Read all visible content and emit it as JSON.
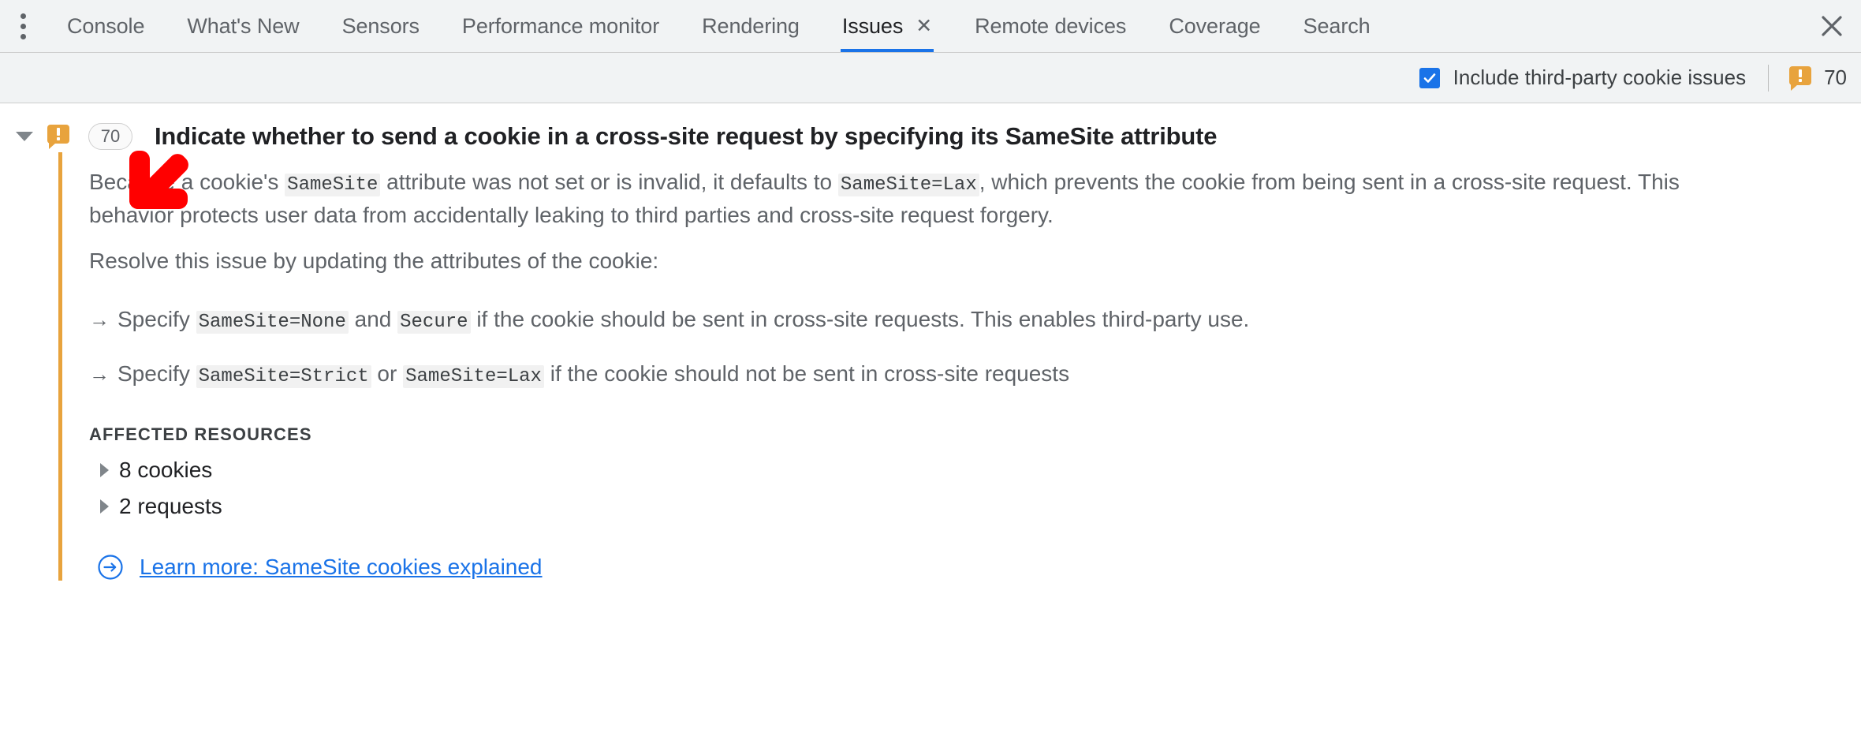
{
  "tabbar": {
    "menu_icon": "three-dot-vertical-menu-icon",
    "tabs": [
      {
        "label": "Console",
        "active": false
      },
      {
        "label": "What's New",
        "active": false
      },
      {
        "label": "Sensors",
        "active": false
      },
      {
        "label": "Performance monitor",
        "active": false
      },
      {
        "label": "Rendering",
        "active": false
      },
      {
        "label": "Issues",
        "active": true,
        "close_label": "✕"
      },
      {
        "label": "Remote devices",
        "active": false
      },
      {
        "label": "Coverage",
        "active": false
      },
      {
        "label": "Search",
        "active": false
      }
    ],
    "close_icon": "close-icon",
    "accent_color": "#1a73e8"
  },
  "toolbar": {
    "third_party_checkbox": {
      "label": "Include third-party cookie issues",
      "checked": true
    },
    "issue_count_icon": "warning-issue-icon",
    "issue_count": "70",
    "warning_color": "#e8a33d"
  },
  "issue": {
    "expanded": true,
    "expand_icon": "chevron-down-icon",
    "severity_icon": "warning-issue-icon",
    "count_badge": "70",
    "title": "Indicate whether to send a cookie in a cross-site request by specifying its SameSite attribute",
    "description": {
      "p1_a": "Because a cookie's ",
      "p1_code1": "SameSite",
      "p1_b": " attribute was not set or is invalid, it defaults to ",
      "p1_code2": "SameSite=Lax",
      "p1_c": ", which prevents the cookie from being sent in a cross-site request. This behavior protects user data from accidentally leaking to third parties and cross-site request forgery."
    },
    "resolve_intro": "Resolve this issue by updating the attributes of the cookie:",
    "fix_arrow_glyph": "→",
    "fixes": [
      {
        "a": "Specify ",
        "code1": "SameSite=None",
        "b": " and ",
        "code2": "Secure",
        "c": " if the cookie should be sent in cross-site requests. This enables third-party use."
      },
      {
        "a": "Specify ",
        "code1": "SameSite=Strict",
        "b": " or ",
        "code2": "SameSite=Lax",
        "c": " if the cookie should not be sent in cross-site requests"
      }
    ],
    "affected_resources_title": "AFFECTED RESOURCES",
    "affected_resources": [
      {
        "label": "8 cookies",
        "icon": "chevron-right-icon",
        "expanded": false
      },
      {
        "label": "2 requests",
        "icon": "chevron-right-icon",
        "expanded": false
      }
    ],
    "learn_more": {
      "icon": "circled-arrow-right-icon",
      "text": "Learn more: SameSite cookies explained",
      "color": "#1a73e8"
    },
    "accent_bar_color": "#e8a33d"
  },
  "annotation": {
    "arrow_icon": "red-arrow-down-left-annotation",
    "color": "#ff0000"
  }
}
